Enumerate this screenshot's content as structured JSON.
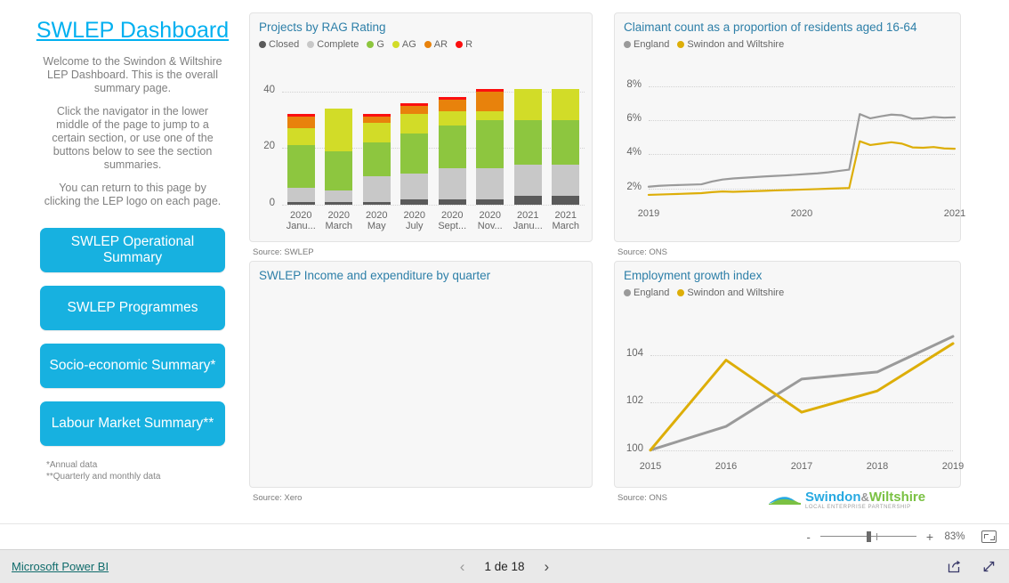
{
  "left_panel": {
    "title": "SWLEP Dashboard ",
    "title_color": "#00b0f0",
    "paragraphs": [
      "Welcome to the Swindon & Wiltshire LEP Dashboard. This is the overall summary page.",
      "Click the navigator in the lower middle of the page to jump to a certain section, or use one of the buttons below to see the section summaries.",
      "You can return to this page by clicking the LEP logo on each page."
    ],
    "buttons": [
      {
        "label": "SWLEP Operational Summary",
        "name": "swlep-operational-summary"
      },
      {
        "label": "SWLEP Programmes",
        "name": "swlep-programmes"
      },
      {
        "label": "Socio-economic Summary*",
        "name": "socio-economic-summary"
      },
      {
        "label": "Labour Market Summary**",
        "name": "labour-market-summary"
      }
    ],
    "button_color": "#17b1e0",
    "footnotes": [
      "*Annual data",
      "**Quarterly and monthly data"
    ]
  },
  "cards": {
    "rag": {
      "title": "Projects by RAG Rating",
      "source": "Source: SWLEP"
    },
    "income": {
      "title": "SWLEP Income and expenditure by quarter",
      "source": "Source: Xero"
    },
    "claimant": {
      "title": "Claimant count as a proportion of residents aged 16-64",
      "source": "Source: ONS"
    },
    "employment": {
      "title": "Employment growth index",
      "source": "Source: ONS"
    }
  },
  "logo": {
    "part1": "Swindon",
    "amp": "&",
    "part2": "Wiltshire",
    "subtitle": "LOCAL ENTERPRISE PARTNERSHIP"
  },
  "zoom_bar": {
    "minus": "-",
    "plus": "+",
    "percent": "83%",
    "fit_to_page_icon": "fit-to-page-icon"
  },
  "status_bar": {
    "brand": "Microsoft Power BI",
    "prev_icon": "‹",
    "next_icon": "›",
    "page_indicator": "1 de 18",
    "share_icon": "share-icon",
    "fullscreen_icon": "fullscreen-icon"
  },
  "chart_data": [
    {
      "id": "rag",
      "type": "bar",
      "stacked": true,
      "title": "Projects by RAG Rating",
      "xlabel": "",
      "ylabel": "",
      "ylim": [
        0,
        44
      ],
      "yticks": [
        0,
        20,
        40
      ],
      "ytick_labels": [
        "0",
        "20",
        "40"
      ],
      "grid": true,
      "legend_position": "top",
      "categories": [
        "2020 Janu...",
        "2020 March",
        "2020 May",
        "2020 July",
        "2020 Sept...",
        "2020 Nov...",
        "2021 Janu...",
        "2021 March"
      ],
      "category_lines": [
        [
          "2020",
          "Janu..."
        ],
        [
          "2020",
          "March"
        ],
        [
          "2020",
          "May"
        ],
        [
          "2020",
          "July"
        ],
        [
          "2020",
          "Sept..."
        ],
        [
          "2020",
          "Nov..."
        ],
        [
          "2021",
          "Janu..."
        ],
        [
          "2021",
          "March"
        ]
      ],
      "series": [
        {
          "name": "Closed",
          "color": "#5a5a5a",
          "values": [
            1,
            1,
            1,
            2,
            2,
            2,
            3,
            3
          ]
        },
        {
          "name": "Complete",
          "color": "#c8c8c8",
          "values": [
            5,
            4,
            9,
            9,
            11,
            11,
            11,
            11
          ]
        },
        {
          "name": "G",
          "color": "#8dc63f",
          "values": [
            15,
            14,
            12,
            14,
            15,
            17,
            16,
            16
          ]
        },
        {
          "name": "AG",
          "color": "#d2dc28",
          "values": [
            6,
            15,
            7,
            7,
            5,
            3,
            11,
            11
          ]
        },
        {
          "name": "AR",
          "color": "#e8820c",
          "values": [
            4,
            0,
            2,
            3,
            4,
            7,
            0,
            0
          ]
        },
        {
          "name": "R",
          "color": "#fb0f0f",
          "values": [
            1,
            0,
            1,
            1,
            1,
            1,
            0,
            0
          ]
        }
      ],
      "totals": [
        32,
        34,
        32,
        36,
        38,
        41,
        41,
        41
      ]
    },
    {
      "id": "income",
      "type": "bar",
      "title": "SWLEP Income and expenditure by quarter",
      "note": "No data rendered in this visual",
      "categories": [],
      "series": []
    },
    {
      "id": "claimant",
      "type": "line",
      "title": "Claimant count as a proportion of residents aged 16-64",
      "xlabel": "",
      "ylabel": "",
      "ylim": [
        1.2,
        8.6
      ],
      "yticks": [
        2,
        4,
        6,
        8
      ],
      "ytick_labels": [
        "2%",
        "4%",
        "6%",
        "8%"
      ],
      "xticks": [
        "2019",
        "2020",
        "2021"
      ],
      "grid": true,
      "legend_position": "top",
      "series": [
        {
          "name": "England",
          "color": "#9a9a9a",
          "values": [
            2.1,
            2.15,
            2.18,
            2.2,
            2.22,
            2.24,
            2.4,
            2.52,
            2.58,
            2.62,
            2.66,
            2.7,
            2.73,
            2.76,
            2.8,
            2.84,
            2.88,
            2.94,
            3.02,
            3.1,
            6.35,
            6.1,
            6.22,
            6.32,
            6.28,
            6.08,
            6.1,
            6.18,
            6.14,
            6.16
          ]
        },
        {
          "name": "Swindon and Wiltshire",
          "color": "#ddae08",
          "values": [
            1.62,
            1.64,
            1.66,
            1.68,
            1.7,
            1.72,
            1.78,
            1.82,
            1.8,
            1.82,
            1.84,
            1.86,
            1.88,
            1.9,
            1.92,
            1.94,
            1.96,
            1.98,
            2.0,
            2.02,
            4.76,
            4.54,
            4.62,
            4.7,
            4.62,
            4.4,
            4.38,
            4.42,
            4.34,
            4.32
          ]
        }
      ]
    },
    {
      "id": "employment",
      "type": "line",
      "title": "Employment growth index",
      "xlabel": "",
      "ylabel": "",
      "ylim": [
        99.8,
        105.4
      ],
      "yticks": [
        100,
        102,
        104
      ],
      "ytick_labels": [
        "100",
        "102",
        "104"
      ],
      "xticks": [
        "2015",
        "2016",
        "2017",
        "2018",
        "2019"
      ],
      "grid": true,
      "legend_position": "top",
      "series": [
        {
          "name": "England",
          "color": "#9a9a9a",
          "values": [
            100.0,
            101.0,
            103.0,
            103.3,
            104.8
          ]
        },
        {
          "name": "Swindon and Wiltshire",
          "color": "#ddae08",
          "values": [
            100.0,
            103.8,
            101.6,
            102.5,
            104.5
          ]
        }
      ]
    }
  ]
}
